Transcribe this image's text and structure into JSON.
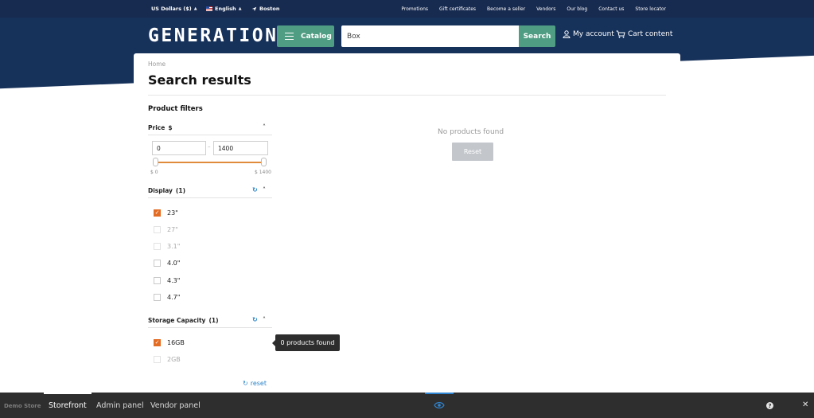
{
  "topbar": {
    "currency": "US Dollars ($)",
    "language": "English",
    "location": "Boston",
    "links": [
      "Promotions",
      "Gift certificates",
      "Become a seller",
      "Vendors",
      "Our blog",
      "Contact us",
      "Store locator"
    ]
  },
  "header": {
    "logo": "GENERATION Z",
    "catalog_label": "Catalog",
    "search_value": "Box",
    "search_button": "Search",
    "account_label": "My account",
    "cart_label": "Cart content"
  },
  "page": {
    "breadcrumb": "Home",
    "title": "Search results"
  },
  "filters": {
    "heading": "Product filters",
    "price": {
      "label": "Price",
      "currency": "$",
      "min_value": "0",
      "max_value": "1400",
      "min_tick": "$ 0",
      "max_tick": "$ 1400",
      "selected_min_fraction": 0,
      "selected_max_fraction": 1
    },
    "display": {
      "label": "Display",
      "count": "(1)",
      "options": [
        {
          "label": "23\"",
          "checked": true,
          "enabled": true
        },
        {
          "label": "27\"",
          "checked": false,
          "enabled": false
        },
        {
          "label": "3.1\"",
          "checked": false,
          "enabled": false
        },
        {
          "label": "4.0\"",
          "checked": false,
          "enabled": true
        },
        {
          "label": "4.3\"",
          "checked": false,
          "enabled": true
        },
        {
          "label": "4.7\"",
          "checked": false,
          "enabled": true
        }
      ]
    },
    "storage": {
      "label": "Storage Capacity",
      "count": "(1)",
      "options": [
        {
          "label": "16GB",
          "checked": true,
          "enabled": true
        },
        {
          "label": "2GB",
          "checked": false,
          "enabled": false
        }
      ]
    },
    "reset_label": "reset"
  },
  "tooltip": "0 products found",
  "results": {
    "empty_text": "No products found",
    "reset_button": "Reset"
  },
  "bottombar": {
    "store_label": "Demo Store",
    "tabs": [
      "Storefront",
      "Admin panel",
      "Vendor panel"
    ],
    "active_tab": "Storefront"
  },
  "colors": {
    "header_bg": "#16315a",
    "accent_green": "#4f9d83",
    "checkbox_orange": "#e36c24",
    "link_blue": "#2a85c8"
  }
}
